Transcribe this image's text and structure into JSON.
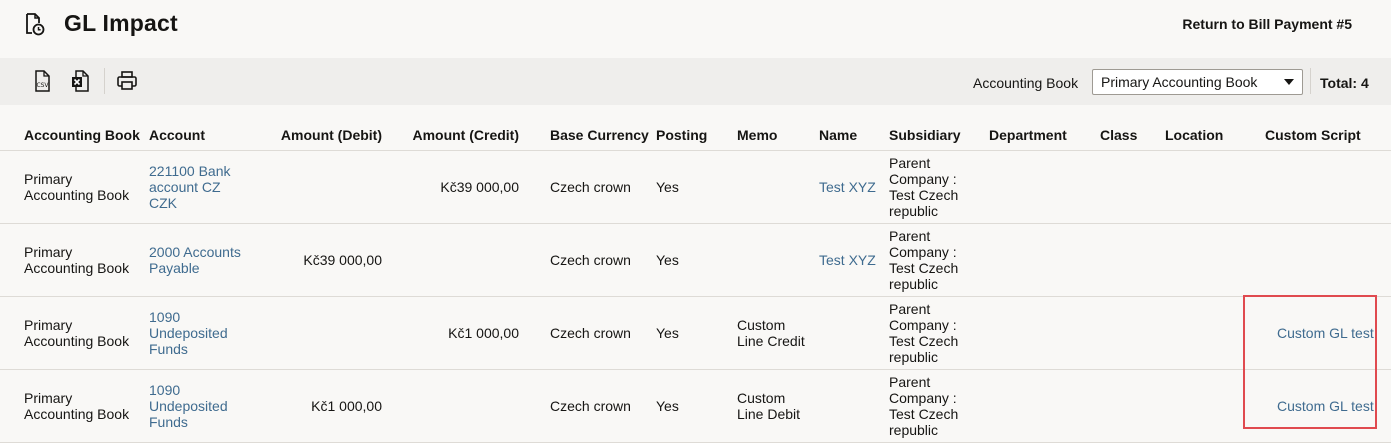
{
  "page": {
    "title": "GL Impact",
    "return_link": "Return to Bill Payment #5"
  },
  "toolbar": {
    "icons": [
      "csv-export-icon",
      "excel-export-icon",
      "print-icon"
    ],
    "book_label": "Accounting Book",
    "book_value": "Primary Accounting Book",
    "total": "Total: 4"
  },
  "table": {
    "headers": {
      "book": "Accounting Book",
      "account": "Account",
      "debit": "Amount (Debit)",
      "credit": "Amount (Credit)",
      "currency": "Base Currency",
      "posting": "Posting",
      "memo": "Memo",
      "name": "Name",
      "subsidiary": "Subsidiary",
      "department": "Department",
      "class": "Class",
      "location": "Location",
      "script": "Custom Script"
    },
    "rows": [
      {
        "book": "Primary Accounting Book",
        "account": "221100 Bank account CZ CZK",
        "debit": "",
        "credit": "Kč39 000,00",
        "currency": "Czech crown",
        "posting": "Yes",
        "memo": "",
        "name": "Test XYZ",
        "subsidiary": "Parent Company : Test Czech republic",
        "department": "",
        "class": "",
        "location": "",
        "script": ""
      },
      {
        "book": "Primary Accounting Book",
        "account": "2000 Accounts Payable",
        "debit": "Kč39 000,00",
        "credit": "",
        "currency": "Czech crown",
        "posting": "Yes",
        "memo": "",
        "name": "Test XYZ",
        "subsidiary": "Parent Company : Test Czech republic",
        "department": "",
        "class": "",
        "location": "",
        "script": ""
      },
      {
        "book": "Primary Accounting Book",
        "account": "1090 Undeposited Funds",
        "debit": "",
        "credit": "Kč1 000,00",
        "currency": "Czech crown",
        "posting": "Yes",
        "memo": "Custom Line Credit",
        "name": "",
        "subsidiary": "Parent Company : Test Czech republic",
        "department": "",
        "class": "",
        "location": "",
        "script": "Custom GL test"
      },
      {
        "book": "Primary Accounting Book",
        "account": "1090 Undeposited Funds",
        "debit": "Kč1 000,00",
        "credit": "",
        "currency": "Czech crown",
        "posting": "Yes",
        "memo": "Custom Line Debit",
        "name": "",
        "subsidiary": "Parent Company : Test Czech republic",
        "department": "",
        "class": "",
        "location": "",
        "script": "Custom GL test"
      }
    ]
  },
  "colors": {
    "background": "#f9f8f6",
    "toolbar": "#efeeec",
    "link": "#3f6b8f",
    "highlight": "#e04a4f"
  }
}
